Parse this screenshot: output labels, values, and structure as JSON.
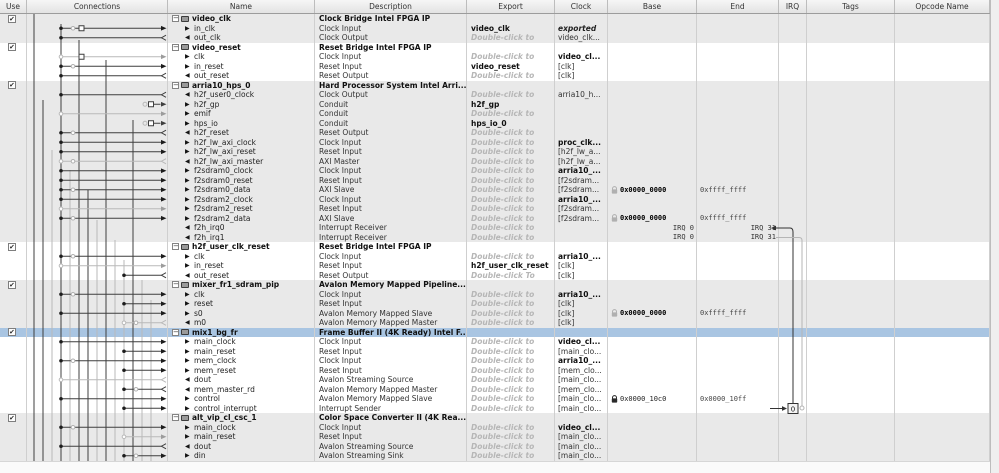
{
  "header": {
    "columns": [
      "Use",
      "Connections",
      "Name",
      "Description",
      "Export",
      "Clock",
      "Base",
      "End",
      "IRQ",
      "Tags",
      "Opcode Name",
      ""
    ]
  },
  "icons": {
    "collapse": "−",
    "check": "✔",
    "port_in": "▶",
    "port_out": "◀"
  },
  "colors": {
    "selected_row": "#a9c5e2",
    "group_shade": "#e9e9e9",
    "wire_dark": "#3f3f3f",
    "wire_light": "#b9b9b9",
    "placeholder_text": "#b6b6b6"
  },
  "irq": {
    "box_value": "0"
  },
  "rows": [
    {
      "kind": "component",
      "name": "video_clk",
      "description": "Clock Bridge Intel FPGA IP",
      "checked": true,
      "group": 0
    },
    {
      "kind": "port",
      "dir": "in",
      "name": "in_clk",
      "description": "Clock Input",
      "export": {
        "text": "video_clk",
        "style": "name"
      },
      "clock": {
        "text": "exported",
        "style": "exported"
      }
    },
    {
      "kind": "port",
      "dir": "out",
      "name": "out_clk",
      "description": "Clock Output",
      "export": {
        "text": "Double-click to",
        "style": "placeholder"
      },
      "clock": {
        "text": "video_clk...",
        "style": "plain"
      }
    },
    {
      "kind": "component",
      "name": "video_reset",
      "description": "Reset Bridge Intel FPGA IP",
      "checked": true,
      "group": 1
    },
    {
      "kind": "port",
      "dir": "in",
      "name": "clk",
      "description": "Clock Input",
      "export": {
        "text": "Double-click to",
        "style": "placeholder"
      },
      "clock": {
        "text": "video_cl...",
        "style": "bold"
      }
    },
    {
      "kind": "port",
      "dir": "in",
      "name": "in_reset",
      "description": "Reset Input",
      "export": {
        "text": "video_reset",
        "style": "name"
      },
      "clock": {
        "text": "[clk]",
        "style": "plain"
      }
    },
    {
      "kind": "port",
      "dir": "out",
      "name": "out_reset",
      "description": "Reset Output",
      "export": {
        "text": "Double-click to",
        "style": "placeholder"
      },
      "clock": {
        "text": "[clk]",
        "style": "plain"
      }
    },
    {
      "kind": "component",
      "name": "arria10_hps_0",
      "description": "Hard Processor System Intel Arri...",
      "checked": true,
      "group": 2
    },
    {
      "kind": "port",
      "dir": "out",
      "name": "h2f_user0_clock",
      "description": "Clock Output",
      "export": {
        "text": "Double-click to",
        "style": "placeholder"
      },
      "clock": {
        "text": "arria10_h...",
        "style": "plain"
      }
    },
    {
      "kind": "port",
      "dir": "in",
      "name": "h2f_gp",
      "description": "Conduit",
      "export": {
        "text": "h2f_gp",
        "style": "name"
      },
      "stub": true
    },
    {
      "kind": "port",
      "dir": "in",
      "name": "emif",
      "description": "Conduit",
      "export": {
        "text": "Double-click to",
        "style": "placeholder"
      }
    },
    {
      "kind": "port",
      "dir": "in",
      "name": "hps_io",
      "description": "Conduit",
      "export": {
        "text": "hps_io_0",
        "style": "name"
      },
      "stub": true
    },
    {
      "kind": "port",
      "dir": "out",
      "name": "h2f_reset",
      "description": "Reset Output",
      "export": {
        "text": "Double-click to",
        "style": "placeholder"
      }
    },
    {
      "kind": "port",
      "dir": "in",
      "name": "h2f_lw_axi_clock",
      "description": "Clock Input",
      "export": {
        "text": "Double-click to",
        "style": "placeholder"
      },
      "clock": {
        "text": "proc_clk...",
        "style": "bold"
      }
    },
    {
      "kind": "port",
      "dir": "in",
      "name": "h2f_lw_axi_reset",
      "description": "Reset Input",
      "export": {
        "text": "Double-click to",
        "style": "placeholder"
      },
      "clock": {
        "text": "[h2f_lw_a...",
        "style": "plain"
      }
    },
    {
      "kind": "port",
      "dir": "out",
      "name": "h2f_lw_axi_master",
      "description": "AXI Master",
      "export": {
        "text": "Double-click to",
        "style": "placeholder"
      },
      "clock": {
        "text": "[h2f_lw_a...",
        "style": "plain"
      }
    },
    {
      "kind": "port",
      "dir": "in",
      "name": "f2sdram0_clock",
      "description": "Clock Input",
      "export": {
        "text": "Double-click to",
        "style": "placeholder"
      },
      "clock": {
        "text": "arria10_...",
        "style": "bold"
      }
    },
    {
      "kind": "port",
      "dir": "in",
      "name": "f2sdram0_reset",
      "description": "Reset Input",
      "export": {
        "text": "Double-click to",
        "style": "placeholder"
      },
      "clock": {
        "text": "[f2sdram...",
        "style": "plain"
      }
    },
    {
      "kind": "port",
      "dir": "in",
      "name": "f2sdram0_data",
      "description": "AXI Slave",
      "export": {
        "text": "Double-click to",
        "style": "placeholder"
      },
      "clock": {
        "text": "[f2sdram...",
        "style": "plain"
      },
      "base": {
        "text": "0x0000_0000",
        "bold": true,
        "icon": "pin"
      },
      "end": "0xffff_ffff"
    },
    {
      "kind": "port",
      "dir": "in",
      "name": "f2sdram2_clock",
      "description": "Clock Input",
      "export": {
        "text": "Double-click to",
        "style": "placeholder"
      },
      "clock": {
        "text": "arria10_...",
        "style": "bold"
      }
    },
    {
      "kind": "port",
      "dir": "in",
      "name": "f2sdram2_reset",
      "description": "Reset Input",
      "export": {
        "text": "Double-click to",
        "style": "placeholder"
      },
      "clock": {
        "text": "[f2sdram...",
        "style": "plain"
      }
    },
    {
      "kind": "port",
      "dir": "in",
      "name": "f2sdram2_data",
      "description": "AXI Slave",
      "export": {
        "text": "Double-click to",
        "style": "placeholder"
      },
      "clock": {
        "text": "[f2sdram...",
        "style": "plain"
      },
      "base": {
        "text": "0x0000_0000",
        "bold": true,
        "icon": "pin"
      },
      "end": "0xffff_ffff"
    },
    {
      "kind": "port",
      "dir": "out",
      "name": "f2h_irq0",
      "description": "Interrupt Receiver",
      "export": {
        "text": "Double-click to",
        "style": "placeholder"
      },
      "irq_base": "IRQ 0",
      "irq_end": "IRQ 31"
    },
    {
      "kind": "port",
      "dir": "out",
      "name": "f2h_irq1",
      "description": "Interrupt Receiver",
      "export": {
        "text": "Double-click to",
        "style": "placeholder"
      },
      "irq_base": "IRQ 0",
      "irq_end": "IRQ 31"
    },
    {
      "kind": "component",
      "name": "h2f_user_clk_reset",
      "description": "Reset Bridge Intel FPGA IP",
      "checked": true,
      "group": 3
    },
    {
      "kind": "port",
      "dir": "in",
      "name": "clk",
      "description": "Clock Input",
      "export": {
        "text": "Double-click to",
        "style": "placeholder"
      },
      "clock": {
        "text": "arria10_...",
        "style": "bold"
      }
    },
    {
      "kind": "port",
      "dir": "in",
      "name": "in_reset",
      "description": "Reset Input",
      "export": {
        "text": "h2f_user_clk_reset",
        "style": "name"
      },
      "clock": {
        "text": "[clk]",
        "style": "plain"
      }
    },
    {
      "kind": "port",
      "dir": "out",
      "name": "out_reset",
      "description": "Reset Output",
      "export": {
        "text": "Double-click To",
        "style": "placeholder"
      },
      "clock": {
        "text": "[clk]",
        "style": "plain"
      }
    },
    {
      "kind": "component",
      "name": "mixer_fr1_sdram_pip",
      "description": "Avalon Memory Mapped Pipeline...",
      "checked": true,
      "group": 4
    },
    {
      "kind": "port",
      "dir": "in",
      "name": "clk",
      "description": "Clock Input",
      "export": {
        "text": "Double-click to",
        "style": "placeholder"
      },
      "clock": {
        "text": "arria10_...",
        "style": "bold"
      }
    },
    {
      "kind": "port",
      "dir": "in",
      "name": "reset",
      "description": "Reset Input",
      "export": {
        "text": "Double-click to",
        "style": "placeholder"
      },
      "clock": {
        "text": "[clk]",
        "style": "plain"
      }
    },
    {
      "kind": "port",
      "dir": "in",
      "name": "s0",
      "description": "Avalon Memory Mapped Slave",
      "export": {
        "text": "Double-click to",
        "style": "placeholder"
      },
      "clock": {
        "text": "[clk]",
        "style": "plain"
      },
      "base": {
        "text": "0x0000_0000",
        "bold": true,
        "icon": "pin"
      },
      "end": "0xffff_ffff"
    },
    {
      "kind": "port",
      "dir": "out",
      "name": "m0",
      "description": "Avalon Memory Mapped Master",
      "export": {
        "text": "Double-click to",
        "style": "placeholder"
      },
      "clock": {
        "text": "[clk]",
        "style": "plain"
      }
    },
    {
      "kind": "component",
      "name": "mix1_bg_fr",
      "description": "Frame Buffer II (4K Ready) Intel F...",
      "checked": true,
      "group": 5,
      "selected": true
    },
    {
      "kind": "port",
      "dir": "in",
      "name": "main_clock",
      "description": "Clock Input",
      "export": {
        "text": "Double-click to",
        "style": "placeholder"
      },
      "clock": {
        "text": "video_cl...",
        "style": "bold"
      }
    },
    {
      "kind": "port",
      "dir": "in",
      "name": "main_reset",
      "description": "Reset Input",
      "export": {
        "text": "Double-click to",
        "style": "placeholder"
      },
      "clock": {
        "text": "[main_clo...",
        "style": "plain"
      }
    },
    {
      "kind": "port",
      "dir": "in",
      "name": "mem_clock",
      "description": "Clock Input",
      "export": {
        "text": "Double-click to",
        "style": "placeholder"
      },
      "clock": {
        "text": "arria10_...",
        "style": "bold"
      }
    },
    {
      "kind": "port",
      "dir": "in",
      "name": "mem_reset",
      "description": "Reset Input",
      "export": {
        "text": "Double-click to",
        "style": "placeholder"
      },
      "clock": {
        "text": "[mem_clo...",
        "style": "plain"
      }
    },
    {
      "kind": "port",
      "dir": "out",
      "name": "dout",
      "description": "Avalon Streaming Source",
      "export": {
        "text": "Double-click to",
        "style": "placeholder"
      },
      "clock": {
        "text": "[main_clo...",
        "style": "plain"
      }
    },
    {
      "kind": "port",
      "dir": "out",
      "name": "mem_master_rd",
      "description": "Avalon Memory Mapped Master",
      "export": {
        "text": "Double-click to",
        "style": "placeholder"
      },
      "clock": {
        "text": "[mem_clo...",
        "style": "plain"
      }
    },
    {
      "kind": "port",
      "dir": "in",
      "name": "control",
      "description": "Avalon Memory Mapped Slave",
      "export": {
        "text": "Double-click to",
        "style": "placeholder"
      },
      "clock": {
        "text": "[main_clo...",
        "style": "plain"
      },
      "base": {
        "text": "0x0000_10c0",
        "bold": false,
        "icon": "lock"
      },
      "end": "0x0000_10ff"
    },
    {
      "kind": "port",
      "dir": "in",
      "name": "control_interrupt",
      "description": "Interrupt Sender",
      "export": {
        "text": "Double-click to",
        "style": "placeholder"
      },
      "clock": {
        "text": "[main_clo...",
        "style": "plain"
      }
    },
    {
      "kind": "component",
      "name": "alt_vip_cl_csc_1",
      "description": "Color Space Converter II (4K Rea...",
      "checked": true,
      "group": 6
    },
    {
      "kind": "port",
      "dir": "in",
      "name": "main_clock",
      "description": "Clock Input",
      "export": {
        "text": "Double-click to",
        "style": "placeholder"
      },
      "clock": {
        "text": "video_cl...",
        "style": "bold"
      }
    },
    {
      "kind": "port",
      "dir": "in",
      "name": "main_reset",
      "description": "Reset Input",
      "export": {
        "text": "Double-click to",
        "style": "placeholder"
      },
      "clock": {
        "text": "[main_clo...",
        "style": "plain"
      }
    },
    {
      "kind": "port",
      "dir": "out",
      "name": "dout",
      "description": "Avalon Streaming Source",
      "export": {
        "text": "Double-click to",
        "style": "placeholder"
      },
      "clock": {
        "text": "[main_clo...",
        "style": "plain"
      }
    },
    {
      "kind": "port",
      "dir": "in",
      "name": "din",
      "description": "Avalon Streaming Sink",
      "export": {
        "text": "Double-click to",
        "style": "placeholder"
      },
      "clock": {
        "text": "[main_clo...",
        "style": "plain"
      }
    }
  ]
}
